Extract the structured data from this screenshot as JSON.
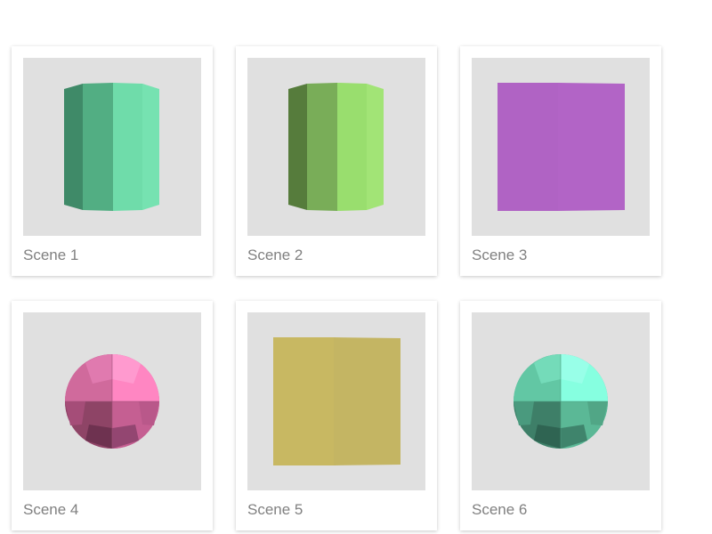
{
  "scenes": [
    {
      "label": "Scene 1",
      "shape": "cylinder",
      "color": "#6fdcaa"
    },
    {
      "label": "Scene 2",
      "shape": "cylinder",
      "color": "#99de6e"
    },
    {
      "label": "Scene 3",
      "shape": "cube",
      "color": "#b063c4"
    },
    {
      "label": "Scene 4",
      "shape": "sphere",
      "color": "#ff80bf"
    },
    {
      "label": "Scene 5",
      "shape": "cube",
      "color": "#c8b862"
    },
    {
      "label": "Scene 6",
      "shape": "sphere",
      "color": "#80ffdd"
    }
  ]
}
